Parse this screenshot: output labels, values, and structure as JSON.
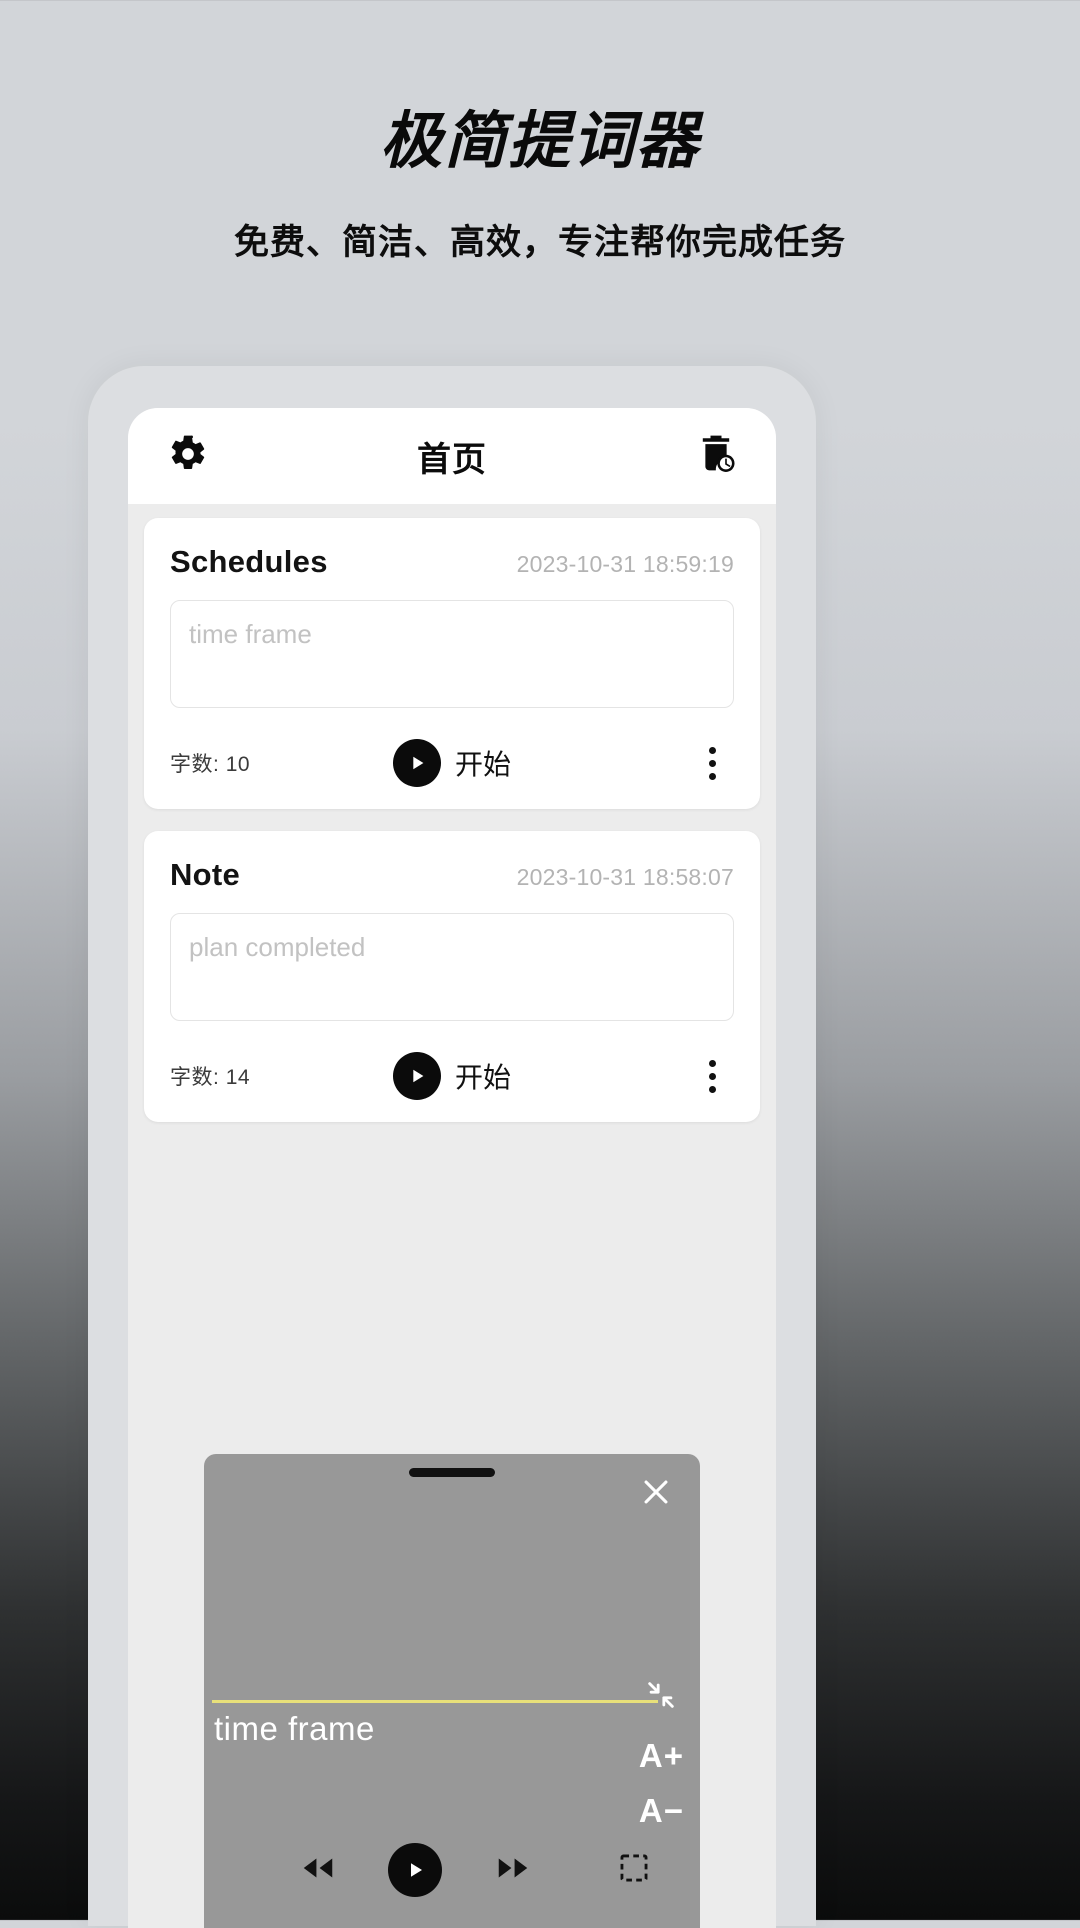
{
  "promo": {
    "title": "极简提词器",
    "subtitle": "免费、简洁、高效，专注帮你完成任务"
  },
  "appbar": {
    "title": "首页",
    "settings_icon": "gear-icon",
    "recycle_icon": "trash-clock-icon"
  },
  "cards": [
    {
      "title": "Schedules",
      "time": "2023-10-31 18:59:19",
      "placeholder": "time frame",
      "value": "",
      "word_count_label": "字数:",
      "word_count": "10",
      "start_label": "开始"
    },
    {
      "title": "Note",
      "time": "2023-10-31 18:58:07",
      "placeholder": "plan completed",
      "value": "",
      "word_count_label": "字数:",
      "word_count": "14",
      "start_label": "开始"
    }
  ],
  "teleprompter": {
    "close_icon": "close-icon",
    "shrink_icon": "shrink-arrows-icon",
    "font_increase": "A+",
    "font_decrease": "A−",
    "script_text": "time frame",
    "marker_color": "#e8e07a",
    "controls": {
      "rewind": "rewind-icon",
      "play": "play-icon",
      "forward": "fast-forward-icon",
      "region": "region-select-icon"
    }
  },
  "colors": {
    "accent": "#e8e07a",
    "panel": "#989898",
    "dark": "#0b0b0b"
  }
}
